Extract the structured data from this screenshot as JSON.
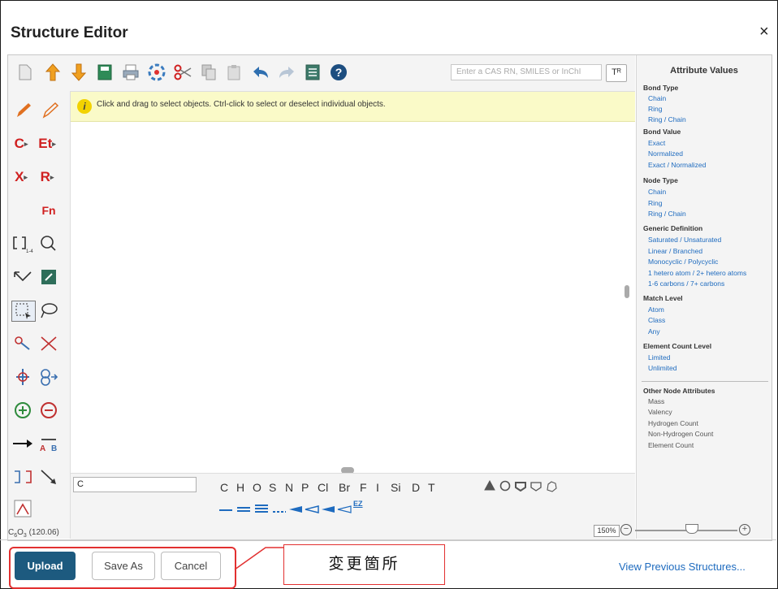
{
  "dialog": {
    "title": "Structure Editor",
    "close_glyph": "×"
  },
  "toolbar": {
    "icons": [
      "new-document-icon",
      "import-icon",
      "export-icon",
      "save-icon",
      "print-icon",
      "templates-icon",
      "cut-icon",
      "copy-icon",
      "paste-icon",
      "undo-icon",
      "redo-icon",
      "list-icon",
      "help-icon"
    ],
    "search_placeholder": "Enter a CAS RN, SMILES or InChI",
    "search_button_label": "Tᴿ"
  },
  "hint": {
    "icon_glyph": "i",
    "text": "Click and drag to select objects. Ctrl-click to select or deselect individual objects."
  },
  "left_tools": {
    "carbon": "C",
    "ethyl": "Et",
    "halogen": "X",
    "r_group": "R",
    "functional_group": "Fn",
    "repeat_label": "1-4"
  },
  "element_input": {
    "value": "C"
  },
  "elements": [
    "C",
    "H",
    "O",
    "S",
    "N",
    "P",
    "Cl",
    "Br",
    "F",
    "I",
    "Si",
    "D",
    "T"
  ],
  "bond_extra": "EZ",
  "attributes": {
    "title": "Attribute Values",
    "groups": [
      {
        "name": "Bond Type",
        "options": [
          "Chain",
          "Ring",
          "Ring / Chain"
        ]
      },
      {
        "name": "Bond Value",
        "options": [
          "Exact",
          "Normalized",
          "Exact / Normalized"
        ]
      },
      {
        "name": "Node Type",
        "options": [
          "Chain",
          "Ring",
          "Ring / Chain"
        ]
      },
      {
        "name": "Generic Definition",
        "options": [
          "Saturated / Unsaturated",
          "Linear / Branched",
          "Monocyclic / Polycyclic",
          "1 hetero atom / 2+ hetero atoms",
          "1-6 carbons / 7+ carbons"
        ]
      },
      {
        "name": "Match Level",
        "options": [
          "Atom",
          "Class",
          "Any"
        ]
      },
      {
        "name": "Element Count Level",
        "options": [
          "Limited",
          "Unlimited"
        ]
      }
    ],
    "other": {
      "name": "Other Node Attributes",
      "items": [
        "Mass",
        "Valency",
        "Hydrogen Count",
        "Non-Hydrogen Count",
        "Element Count"
      ]
    }
  },
  "status": {
    "formula_prefix": "C",
    "formula_sub1": "6",
    "formula_mid": "O",
    "formula_sub2": "3",
    "formula_mass": " (120.06)"
  },
  "zoom": {
    "value": "150%",
    "level_fraction": 0.5
  },
  "actions": {
    "upload": "Upload",
    "save_as": "Save As",
    "cancel": "Cancel",
    "view_previous": "View Previous Structures..."
  },
  "annotation": {
    "callout_text": "変更箇所",
    "color": "#e23030"
  },
  "colors": {
    "primary": "#1d5a7f",
    "link": "#1e6bbf",
    "hint_bg": "#fafac8"
  }
}
